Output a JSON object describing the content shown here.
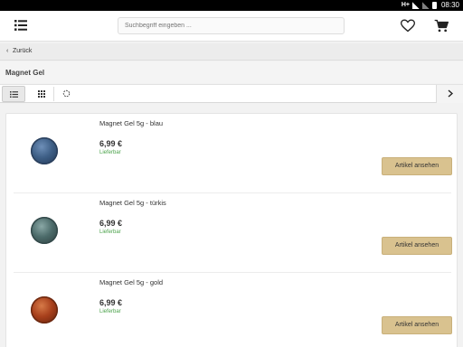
{
  "statusbar": {
    "network": "H+",
    "time": "08:30"
  },
  "header": {
    "search_placeholder": "Suchbegriff eingeben ...",
    "icons": {
      "menu": "list-menu-icon",
      "wishlist": "heart-icon",
      "cart": "cart-icon"
    }
  },
  "nav": {
    "back_label": "Zurück"
  },
  "page": {
    "title": "Magnet Gel"
  },
  "viewbar": {
    "icons": {
      "list": "list-view-icon",
      "grid": "grid-view-icon",
      "refresh": "refresh-icon",
      "next": "chevron-right-icon"
    }
  },
  "products": [
    {
      "name": "Magnet Gel 5g - blau",
      "price": "6,99 €",
      "stock": "Lieferbar",
      "button": "Artikel ansehen",
      "color": "#3e5f86"
    },
    {
      "name": "Magnet Gel 5g - türkis",
      "price": "6,99 €",
      "stock": "Lieferbar",
      "button": "Artikel ansehen",
      "color": "#4c6b6a"
    },
    {
      "name": "Magnet Gel 5g - gold",
      "price": "6,99 €",
      "stock": "Lieferbar",
      "button": "Artikel ansehen",
      "color": "#a8401c"
    }
  ],
  "colors": {
    "accent_button": "#d9c28f",
    "stock_green": "#4aa24a"
  }
}
